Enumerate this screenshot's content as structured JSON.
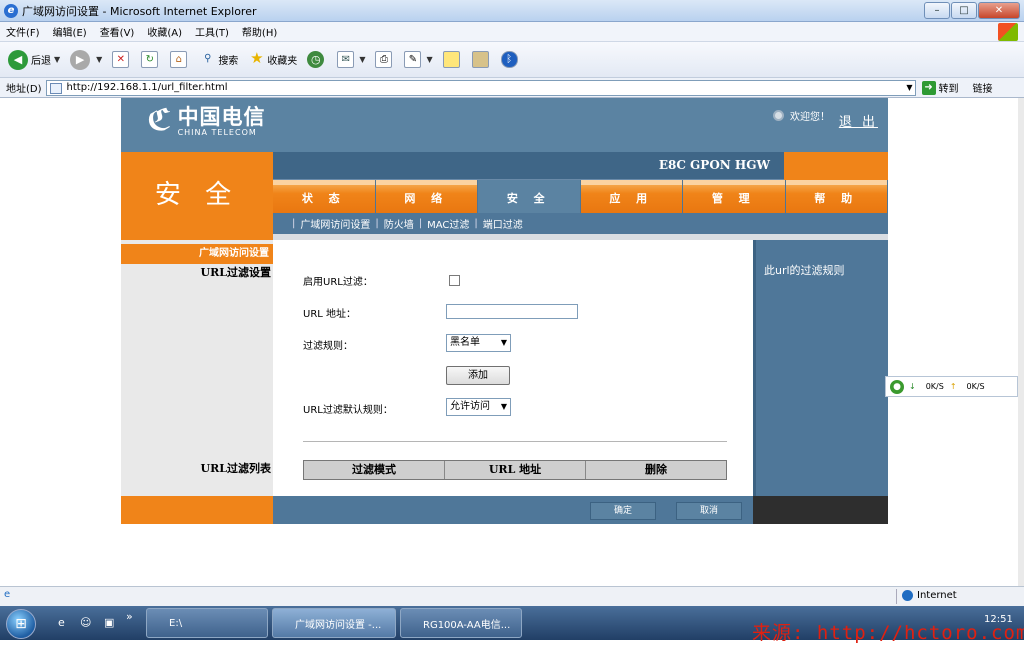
{
  "window": {
    "title": "广域网访问设置 - Microsoft Internet Explorer",
    "min": "–",
    "max": "□",
    "close": "✕"
  },
  "menu": [
    "文件(F)",
    "编辑(E)",
    "查看(V)",
    "收藏(A)",
    "工具(T)",
    "帮助(H)"
  ],
  "toolbar": {
    "back": "后退",
    "search": "搜索",
    "favorites": "收藏夹"
  },
  "address": {
    "label": "地址(D)",
    "url": "http://192.168.1.1/url_filter.html",
    "go": "转到",
    "links": "链接"
  },
  "header": {
    "logo_cn": "中国电信",
    "logo_en": "CHINA TELECOM",
    "welcome": "欢迎您！",
    "logout": "退 出",
    "product": "E8C GPON HGW"
  },
  "section_title": "安 全",
  "nav": [
    {
      "label": "状 态",
      "active": false
    },
    {
      "label": "网 络",
      "active": false
    },
    {
      "label": "安 全",
      "active": true
    },
    {
      "label": "应 用",
      "active": false
    },
    {
      "label": "管 理",
      "active": false
    },
    {
      "label": "帮 助",
      "active": false
    }
  ],
  "subnav": [
    "广域网访问设置",
    "防火墙",
    "MAC过滤",
    "端口过滤"
  ],
  "sidebar": {
    "band": "广域网访问设置",
    "url_filter_settings": "URL过滤设置",
    "url_filter_list": "URL过滤列表"
  },
  "form": {
    "enable_label": "启用URL过滤：",
    "enable_checked": false,
    "url_label": "URL 地址：",
    "url_value": "",
    "rule_label": "过滤规则：",
    "rule_value": "黑名单",
    "add_button": "添加",
    "default_label": "URL过滤默认规则：",
    "default_value": "允许访问"
  },
  "table": {
    "headers": [
      "过滤模式",
      "URL 地址",
      "删除"
    ]
  },
  "help": {
    "text": "此url的过滤规则"
  },
  "footer": {
    "ok": "确定",
    "cancel": "取消"
  },
  "netmon": {
    "down": "0K/S",
    "up": "0K/S"
  },
  "statusbar": {
    "zone": "Internet"
  },
  "taskbar": {
    "items": [
      "E:\\",
      "广域网访问设置 -...",
      "RG100A-AA电信..."
    ],
    "time": "12:51"
  },
  "watermark": "来源: http://hctoro.com"
}
